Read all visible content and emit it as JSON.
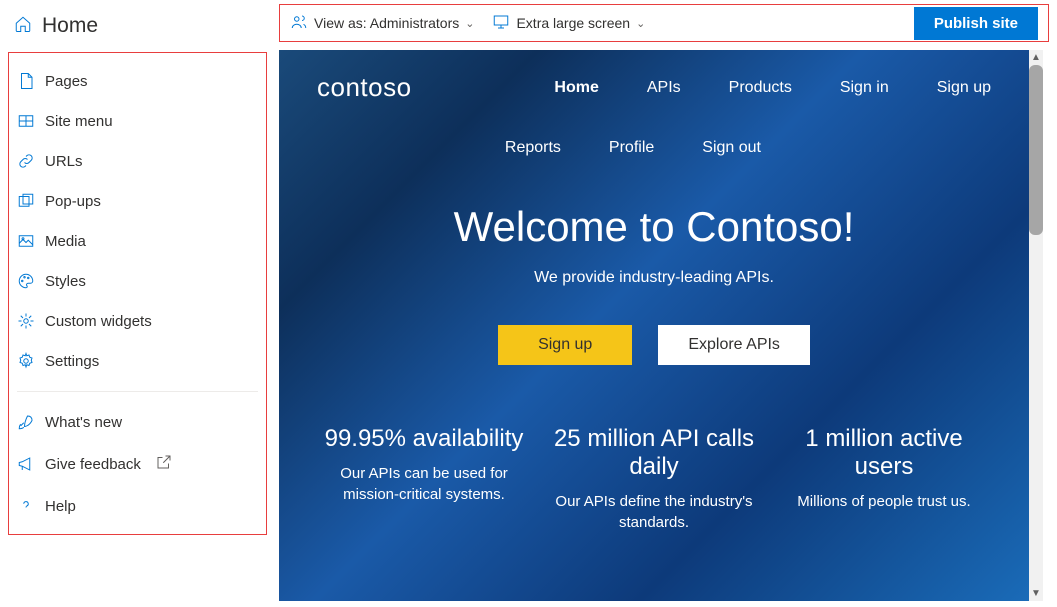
{
  "sidebar": {
    "home": "Home",
    "items": [
      {
        "label": "Pages",
        "icon": "page-icon"
      },
      {
        "label": "Site menu",
        "icon": "sitemap-icon"
      },
      {
        "label": "URLs",
        "icon": "link-icon"
      },
      {
        "label": "Pop-ups",
        "icon": "popups-icon"
      },
      {
        "label": "Media",
        "icon": "media-icon"
      },
      {
        "label": "Styles",
        "icon": "palette-icon"
      },
      {
        "label": "Custom widgets",
        "icon": "widget-icon"
      },
      {
        "label": "Settings",
        "icon": "gear-icon"
      }
    ],
    "footer": [
      {
        "label": "What's new",
        "icon": "rocket-icon"
      },
      {
        "label": "Give feedback",
        "icon": "megaphone-icon",
        "external": true
      },
      {
        "label": "Help",
        "icon": "help-icon"
      }
    ]
  },
  "toolbar": {
    "viewas_label": "View as: Administrators",
    "screen_label": "Extra large screen",
    "publish_label": "Publish site"
  },
  "preview": {
    "logo": "contoso",
    "nav1": [
      "Home",
      "APIs",
      "Products",
      "Sign in",
      "Sign up"
    ],
    "nav2": [
      "Reports",
      "Profile",
      "Sign out"
    ],
    "hero": {
      "title": "Welcome to Contoso!",
      "subtitle": "We provide industry-leading APIs.",
      "signup": "Sign up",
      "explore": "Explore APIs"
    },
    "stats": [
      {
        "title": "99.95% availability",
        "desc": "Our APIs can be used for mission-critical systems."
      },
      {
        "title": "25 million API calls daily",
        "desc": "Our APIs define the industry's standards."
      },
      {
        "title": "1 million active users",
        "desc": "Millions of people trust us."
      }
    ]
  }
}
